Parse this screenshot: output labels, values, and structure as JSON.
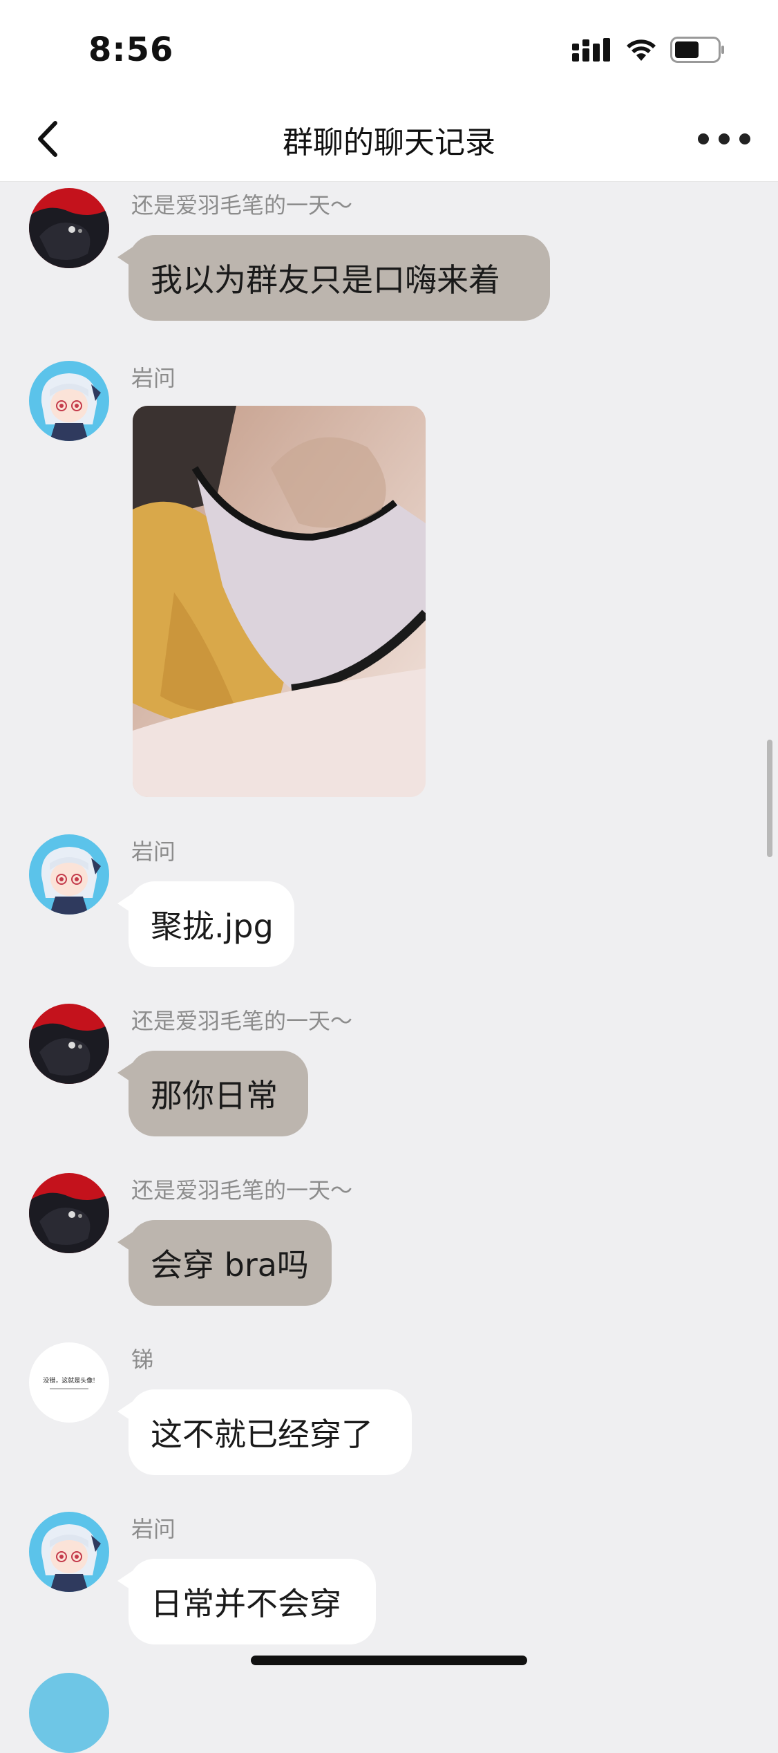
{
  "status": {
    "time": "8:56"
  },
  "header": {
    "title": "群聊的聊天记录"
  },
  "messages": [
    {
      "sender": "还是爱羽毛笔的一天～",
      "text": "我以为群友只是口嗨来着",
      "avatar": "dark-red-avatar",
      "bubble_color": "#bcb5ae"
    },
    {
      "sender": "岩问",
      "type": "image",
      "avatar": "anime-girl-avatar"
    },
    {
      "sender": "岩问",
      "text": "聚拢.jpg",
      "avatar": "anime-girl-avatar",
      "bubble_color": "#ffffff"
    },
    {
      "sender": "还是爱羽毛笔的一天～",
      "text": "那你日常",
      "avatar": "dark-red-avatar",
      "bubble_color": "#bcb5ae"
    },
    {
      "sender": "还是爱羽毛笔的一天～",
      "text": "会穿 bra吗",
      "avatar": "dark-red-avatar",
      "bubble_color": "#bcb5ae"
    },
    {
      "sender": "锑",
      "text": "这不就已经穿了",
      "avatar": "white-text-avatar",
      "avatar_text": "没错，这就是头像!",
      "bubble_color": "#ffffff"
    },
    {
      "sender": "岩问",
      "text": "日常并不会穿",
      "avatar": "anime-girl-avatar",
      "bubble_color": "#ffffff"
    }
  ],
  "icons": {
    "back": "chevron-left-icon",
    "more": "more-dots-icon",
    "signal": "signal-icon",
    "wifi": "wifi-icon",
    "battery": "battery-icon"
  }
}
